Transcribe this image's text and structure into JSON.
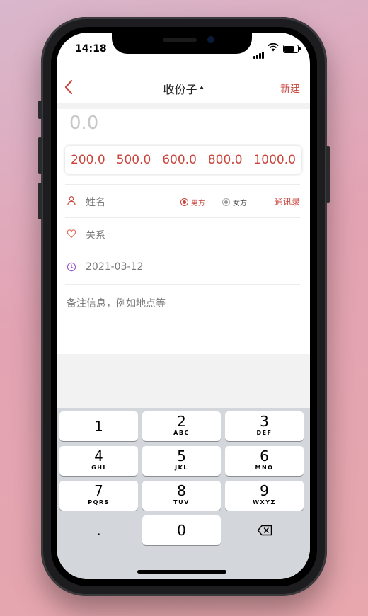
{
  "status": {
    "time": "14:18"
  },
  "nav": {
    "title": "收份子",
    "new_label": "新建"
  },
  "amount": {
    "placeholder": "0.0"
  },
  "presets": [
    "200.0",
    "500.0",
    "600.0",
    "800.0",
    "1000.0"
  ],
  "form": {
    "name_placeholder": "姓名",
    "gender": {
      "male": "男方",
      "female": "女方",
      "selected": "male"
    },
    "contacts_label": "通讯录",
    "relation_placeholder": "关系",
    "date": "2021-03-12",
    "notes_placeholder": "备注信息，例如地点等"
  },
  "keypad": {
    "keys": [
      {
        "digit": "1",
        "letters": ""
      },
      {
        "digit": "2",
        "letters": "ABC"
      },
      {
        "digit": "3",
        "letters": "DEF"
      },
      {
        "digit": "4",
        "letters": "GHI"
      },
      {
        "digit": "5",
        "letters": "JKL"
      },
      {
        "digit": "6",
        "letters": "MNO"
      },
      {
        "digit": "7",
        "letters": "PQRS"
      },
      {
        "digit": "8",
        "letters": "TUV"
      },
      {
        "digit": "9",
        "letters": "WXYZ"
      },
      {
        "digit": "0",
        "letters": ""
      }
    ],
    "decimal": "."
  },
  "colors": {
    "accent": "#c9453b",
    "keyboard_bg": "#d3d6db"
  }
}
